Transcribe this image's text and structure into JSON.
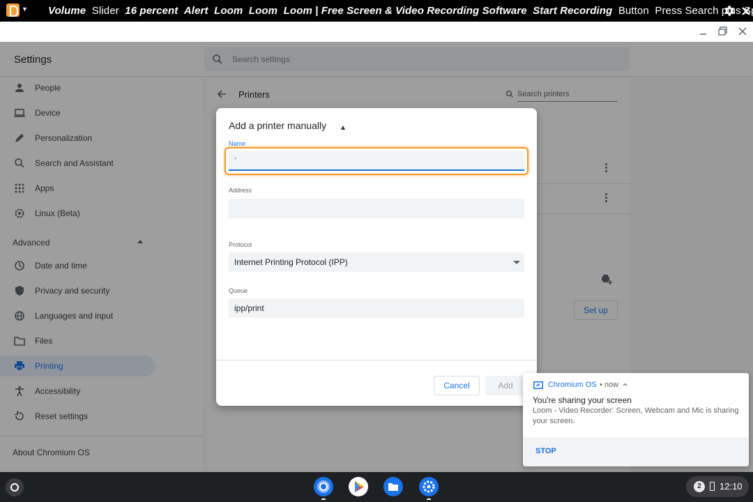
{
  "chromevox": {
    "segments": [
      {
        "text": "Volume",
        "emph": true
      },
      {
        "text": "Slider",
        "emph": false
      },
      {
        "text": "16 percent",
        "emph": true
      },
      {
        "text": "Alert",
        "emph": true
      },
      {
        "text": "Loom",
        "emph": true
      },
      {
        "text": "Loom",
        "emph": true
      },
      {
        "text": "Loom | Free Screen & Video Recording Software",
        "emph": true
      },
      {
        "text": "Start Recording",
        "emph": true
      },
      {
        "text": "Button",
        "emph": false
      },
      {
        "text": "Press Search plus Space to",
        "emph": false
      }
    ]
  },
  "settings": {
    "title": "Settings",
    "search_placeholder": "Search settings",
    "nav": [
      {
        "label": "People",
        "icon": "person-icon"
      },
      {
        "label": "Device",
        "icon": "laptop-icon"
      },
      {
        "label": "Personalization",
        "icon": "pencil-icon"
      },
      {
        "label": "Search and Assistant",
        "icon": "search-icon"
      },
      {
        "label": "Apps",
        "icon": "apps-grid-icon"
      },
      {
        "label": "Linux (Beta)",
        "icon": "linux-gear-icon"
      }
    ],
    "advanced_label": "Advanced",
    "advanced_nav": [
      {
        "label": "Date and time",
        "icon": "clock-icon"
      },
      {
        "label": "Privacy and security",
        "icon": "shield-icon"
      },
      {
        "label": "Languages and input",
        "icon": "globe-icon"
      },
      {
        "label": "Files",
        "icon": "folder-icon"
      },
      {
        "label": "Printing",
        "icon": "printer-icon",
        "active": true
      },
      {
        "label": "Accessibility",
        "icon": "accessibility-icon"
      },
      {
        "label": "Reset settings",
        "icon": "reset-icon"
      }
    ],
    "about_label": "About Chromium OS"
  },
  "printers_page": {
    "title": "Printers",
    "search_placeholder": "Search printers",
    "setup_label": "Set up"
  },
  "dialog": {
    "title": "Add a printer manually",
    "name_label": "Name",
    "name_value": "`",
    "address_label": "Address",
    "address_value": "",
    "protocol_label": "Protocol",
    "protocol_value": "Internet Printing Protocol (IPP)",
    "queue_label": "Queue",
    "queue_value": "ipp/print",
    "cancel_label": "Cancel",
    "add_label": "Add"
  },
  "notification": {
    "source": "Chromium OS",
    "time": "• now",
    "title": "You're sharing your screen",
    "body": "Loom - Video Recorder: Screen, Webcam and Mic is sharing your screen.",
    "action": "STOP"
  },
  "shelf": {
    "apps": [
      "chrome-icon",
      "play-store-icon",
      "files-icon",
      "settings-icon"
    ],
    "notification_count": "2",
    "time": "12:10"
  },
  "colors": {
    "accent": "#1a73e8",
    "focus_ring": "#f39a2b",
    "chromevox_bg": "#000000",
    "shelf_bg": "#1f2023"
  }
}
